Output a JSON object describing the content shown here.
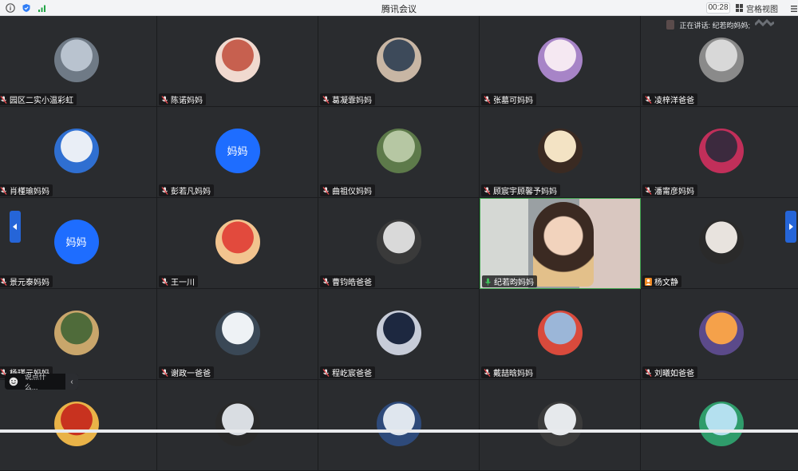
{
  "window": {
    "title": "腾讯会议",
    "timer": "00:28",
    "view_mode": "宫格视图"
  },
  "speaking_indicator": {
    "label": "正在讲话: 纪若昀妈妈;"
  },
  "participants": [
    {
      "name": "园区二实小温彩虹",
      "type": "photo",
      "palette": [
        "#b9c3cf",
        "#6f7a86"
      ]
    },
    {
      "name": "陈诺妈妈",
      "type": "photo",
      "palette": [
        "#c7604f",
        "#f0d9cf"
      ]
    },
    {
      "name": "葛凝霏妈妈",
      "type": "photo",
      "palette": [
        "#3d4a5a",
        "#c8b6a4"
      ]
    },
    {
      "name": "张墓可妈妈",
      "type": "photo",
      "palette": [
        "#f5e8f2",
        "#a784c7"
      ]
    },
    {
      "name": "凌梓洋爸爸",
      "type": "photo",
      "muted": false,
      "palette": [
        "#d8d8d8",
        "#8a8a8a"
      ]
    },
    {
      "name": "肖槿瑜妈妈",
      "type": "photo",
      "palette": [
        "#e9eef6",
        "#2f6fd1"
      ]
    },
    {
      "name": "彭若凡妈妈",
      "type": "text",
      "avatar_text": "妈妈",
      "palette": [
        "#1e6dff",
        "#1e6dff"
      ]
    },
    {
      "name": "曲祖仪妈妈",
      "type": "photo",
      "palette": [
        "#b6c7a3",
        "#5d7a4a"
      ]
    },
    {
      "name": "顾宸宇顾馨予妈妈",
      "type": "photo",
      "palette": [
        "#f3e3c4",
        "#3a2a22"
      ]
    },
    {
      "name": "潘甯彦妈妈",
      "type": "photo",
      "palette": [
        "#3c2a3e",
        "#c12f5a"
      ]
    },
    {
      "name": "景元泰妈妈",
      "type": "text",
      "avatar_text": "妈妈",
      "palette": [
        "#1e6dff",
        "#1e6dff"
      ]
    },
    {
      "name": "王一川",
      "type": "photo",
      "palette": [
        "#e24a3d",
        "#f2c48f"
      ]
    },
    {
      "name": "曹钧皓爸爸",
      "type": "photo",
      "palette": [
        "#d9d9d9",
        "#3a3a3a"
      ]
    },
    {
      "name": "纪若昀妈妈",
      "type": "video",
      "palette": [
        "#cfd2cf",
        "#e6b98d"
      ]
    },
    {
      "name": "杨文静",
      "type": "photo",
      "host": true,
      "palette": [
        "#e8e3de",
        "#2a2a2a"
      ]
    },
    {
      "name": "杨瑾元妈妈",
      "type": "photo",
      "palette": [
        "#4f6b3a",
        "#c9a66b"
      ]
    },
    {
      "name": "谢政一爸爸",
      "type": "photo",
      "palette": [
        "#eef2f5",
        "#3a4856"
      ]
    },
    {
      "name": "程屹宸爸爸",
      "type": "photo",
      "palette": [
        "#1d2840",
        "#c7ccd8"
      ]
    },
    {
      "name": "戴喆晗妈妈",
      "type": "photo",
      "palette": [
        "#9bb6d8",
        "#d94a3c"
      ]
    },
    {
      "name": "刘曦如爸爸",
      "type": "photo",
      "palette": [
        "#f5a14a",
        "#5b4a8a"
      ]
    },
    {
      "name": "",
      "type": "photo",
      "palette": [
        "#c8321f",
        "#e9b348"
      ]
    },
    {
      "name": "",
      "type": "photo",
      "palette": [
        "#d9dde2",
        "#2a2a2a"
      ]
    },
    {
      "name": "",
      "type": "photo",
      "palette": [
        "#dfe6ee",
        "#2e4a7a"
      ]
    },
    {
      "name": "",
      "type": "photo",
      "palette": [
        "#e6e9ec",
        "#3b3b3b"
      ]
    },
    {
      "name": "",
      "type": "photo",
      "palette": [
        "#b4e0ef",
        "#2f9c6b"
      ]
    }
  ],
  "chat": {
    "placeholder": "说点什么...",
    "collapse_icon": "chevron-left-icon"
  },
  "nav": {
    "left_icon": "chevron-left-icon",
    "right_icon": "chevron-right-icon"
  },
  "colors": {
    "accent_blue": "#1e6dff",
    "speaking_green": "#3fa34d",
    "host_orange": "#f08a24"
  }
}
